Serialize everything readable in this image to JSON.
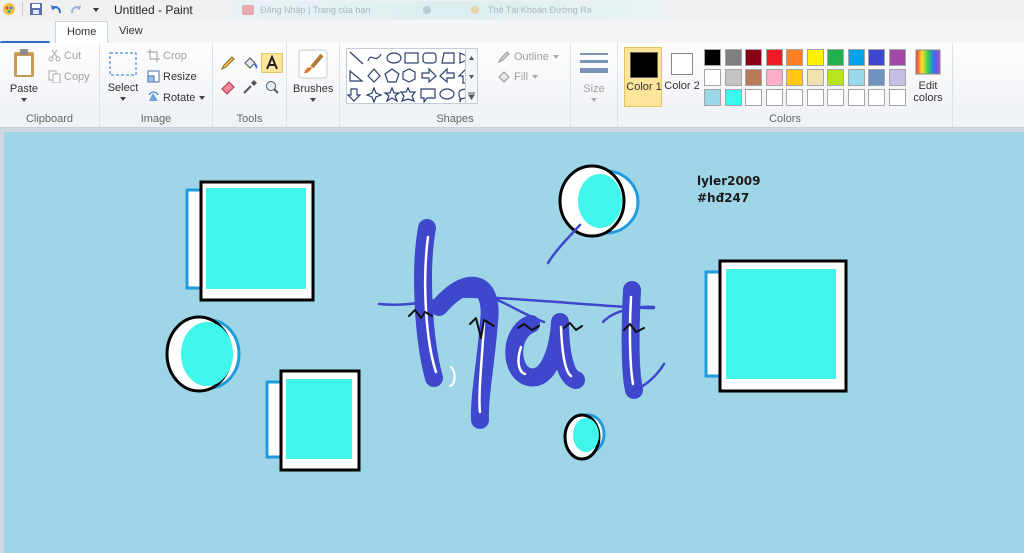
{
  "window": {
    "title": "Untitled - Paint",
    "blurred_tabs": [
      "Đăng Nhập | Trang của bạn",
      "Thẻ Tài Khoản Đường Ra"
    ]
  },
  "tabs": [
    {
      "label": "Home",
      "active": true
    },
    {
      "label": "View",
      "active": false
    }
  ],
  "clipboard": {
    "paste": "Paste",
    "cut": "Cut",
    "copy": "Copy",
    "group": "Clipboard"
  },
  "image": {
    "select": "Select",
    "crop": "Crop",
    "resize": "Resize",
    "rotate": "Rotate",
    "group": "Image"
  },
  "tools": {
    "group": "Tools"
  },
  "brushes": {
    "label": "Brushes"
  },
  "shapes": {
    "outline": "Outline",
    "fill": "Fill",
    "group": "Shapes"
  },
  "size": {
    "label": "Size"
  },
  "colors": {
    "color1": "Color 1",
    "color1_value": "#000000",
    "color2": "Color 2",
    "color2_value": "#ffffff",
    "edit": "Edit colors",
    "group": "Colors",
    "palette_row1": [
      "#000000",
      "#7f7f7f",
      "#880015",
      "#ed1c24",
      "#ff7f27",
      "#fff200",
      "#22b14c",
      "#00a2e8",
      "#3f48cc",
      "#a349a4"
    ],
    "palette_row2": [
      "#ffffff",
      "#c3c3c3",
      "#b97a57",
      "#ffaec9",
      "#ffc90e",
      "#efe4b0",
      "#b5e61d",
      "#99d9ea",
      "#7092be",
      "#c8bfe7"
    ],
    "palette_row3": [
      "#99d9ea",
      "#3bf7ed",
      "#ffffff",
      "#ffffff",
      "#ffffff",
      "#ffffff",
      "#ffffff",
      "#ffffff",
      "#ffffff",
      "#ffffff"
    ]
  },
  "canvas": {
    "signature_line1": "lyler2009",
    "signature_line2": "#hđ247",
    "artwork_text": "hải",
    "colors": {
      "background": "#9ed6e8",
      "cyan": "#40f5ea",
      "blue": "#1f9be0",
      "ink": "#3f48cc"
    }
  }
}
